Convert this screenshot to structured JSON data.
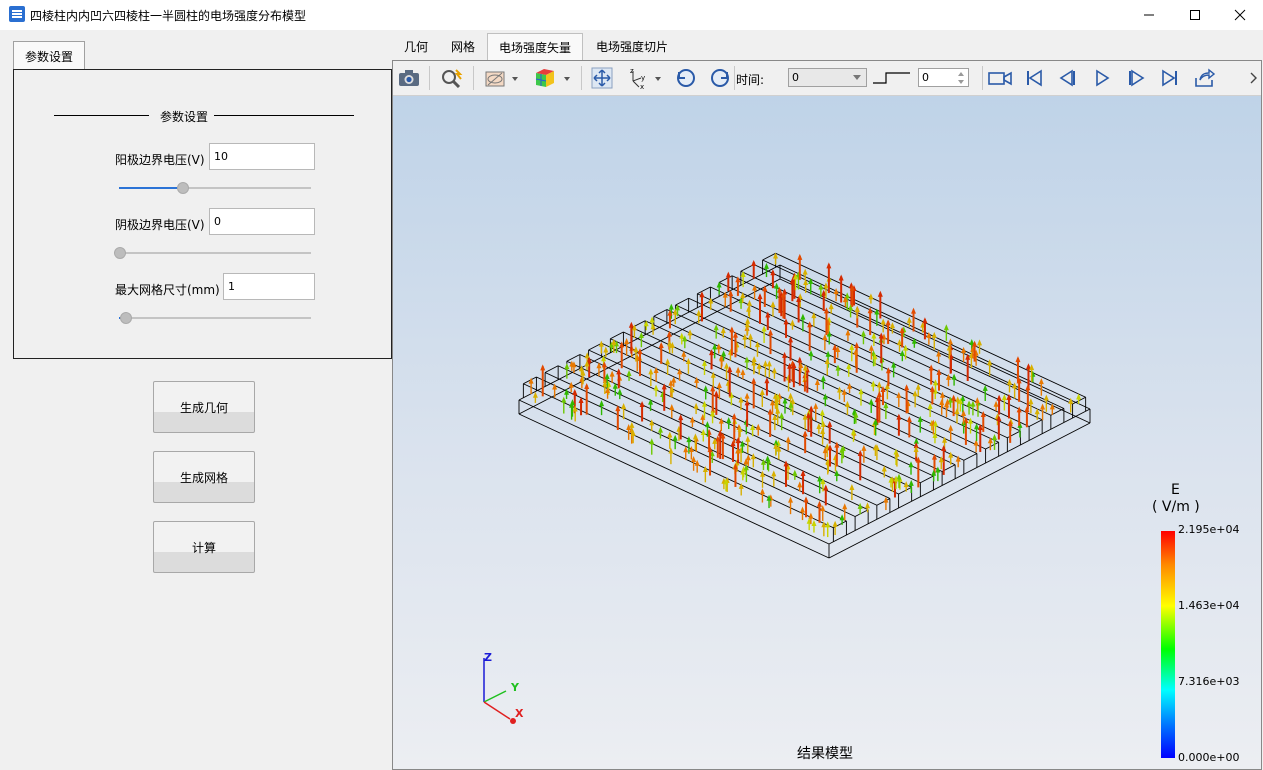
{
  "window": {
    "title": "四棱柱内内凹六四棱柱一半圆柱的电场强度分布模型",
    "min_icon": "minimize-icon",
    "max_icon": "maximize-icon",
    "close_icon": "close-icon"
  },
  "left": {
    "tab_label": "参数设置",
    "group_title": "参数设置",
    "fields": [
      {
        "label": "阳极边界电压(V)",
        "value": "10",
        "slider": 0.33
      },
      {
        "label": "阴极边界电压(V)",
        "value": "0",
        "slider": 0.0
      },
      {
        "label": "最大网格尺寸(mm)",
        "value": "1",
        "slider": 0.03
      }
    ],
    "buttons": {
      "generate_geometry": "生成几何",
      "generate_mesh": "生成网格",
      "compute": "计算"
    }
  },
  "tabs": [
    "几何",
    "网格",
    "电场强度矢量",
    "电场强度切片"
  ],
  "active_tab": 2,
  "toolbar": {
    "time_label": "时间:",
    "time_value": "0",
    "step_value": "0",
    "icons": [
      "camera-icon",
      "zoom-search-icon",
      "surface-display-icon",
      "color-cube-icon",
      "pan-move-icon",
      "axes-orient-icon",
      "rotate-ccw-icon",
      "rotate-cw-icon",
      "video-camera-icon",
      "first-frame-icon",
      "prev-frame-icon",
      "play-icon",
      "next-frame-icon",
      "last-frame-icon",
      "export-icon"
    ]
  },
  "scene": {
    "caption": "结果模型",
    "colorbar": {
      "title": "E",
      "unit": "( V/m )",
      "ticks": [
        "2.195e+04",
        "1.463e+04",
        "7.316e+03",
        "0.000e+00"
      ]
    },
    "axes": {
      "z": "Z",
      "y": "Y",
      "x": "X"
    }
  }
}
